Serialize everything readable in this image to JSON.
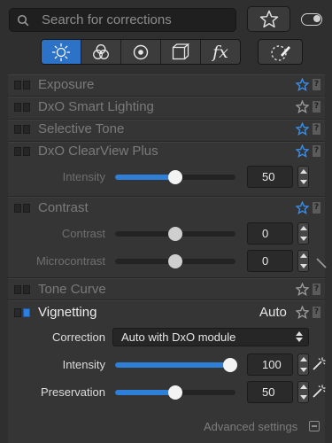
{
  "search": {
    "placeholder": "Search for corrections"
  },
  "tabs": [
    "light-tab",
    "color-tab",
    "detail-tab",
    "geometry-tab",
    "effects-tab"
  ],
  "fx_label": "fx",
  "sections": {
    "exposure": "Exposure",
    "smart_lighting": "DxO Smart Lighting",
    "selective_tone": "Selective Tone",
    "clearview": "DxO ClearView Plus",
    "contrast": "Contrast",
    "tone_curve": "Tone Curve",
    "vignetting": "Vignetting"
  },
  "help_label": "?",
  "clearview_rows": {
    "intensity_label": "Intensity",
    "intensity_value": "50",
    "intensity_fraction": 0.5
  },
  "contrast_rows": {
    "contrast_label": "Contrast",
    "contrast_value": "0",
    "contrast_fraction": 0.5,
    "microcontrast_label": "Microcontrast",
    "microcontrast_value": "0",
    "microcontrast_fraction": 0.5
  },
  "vignetting_rows": {
    "auto_label": "Auto",
    "correction_label": "Correction",
    "correction_value": "Auto with DxO module",
    "intensity_label": "Intensity",
    "intensity_value": "100",
    "intensity_fraction": 1.0,
    "preservation_label": "Preservation",
    "preservation_value": "50",
    "preservation_fraction": 0.5
  },
  "advanced_label": "Advanced settings",
  "colors": {
    "accent": "#2e7fd8",
    "background": "#2f2f2f",
    "panel": "#353535"
  }
}
